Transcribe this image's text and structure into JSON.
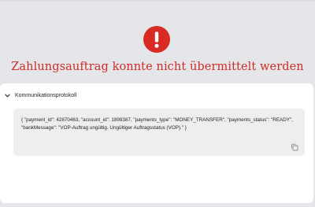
{
  "page": {
    "error_title": "Zahlungsauftrag konnte nicht übermittelt werden",
    "icon": "exclamation-circle-icon",
    "accent_color": "#d82b24"
  },
  "protocol": {
    "title": "Kommunikationsprotokoll",
    "expanded": true,
    "log_text": "{ \"payment_id\": 42870463, \"account_id\": 1899387, \"payments_type\": \"MONEY_TRANSFER\", \"payments_status\": \"READY\", \"bankMessage\": \"VOP-Auftrag ungültig. Ungültiger Auftragsstatus (VOP).\" }",
    "copy_icon": "copy-icon",
    "chevron_icon": "chevron-down-icon"
  }
}
